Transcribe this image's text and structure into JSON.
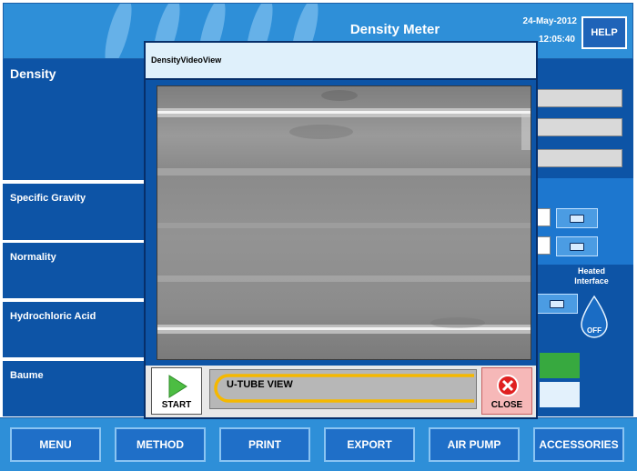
{
  "header": {
    "title": "Density Meter",
    "date": "24-May-2012",
    "time": "12:05:40",
    "help_label": "HELP"
  },
  "left_panels": {
    "density": "Density",
    "specific_gravity": "Specific Gravity",
    "normality": "Normality",
    "hydrochloric_acid": "Hydrochloric Acid",
    "baume": "Baume"
  },
  "right_panel": {
    "heated_interface_label": "Heated Interface",
    "heater_status": "OFF",
    "keyboard_icon": "keyboard-icon",
    "drop_icon": "water-drop-icon"
  },
  "dialog": {
    "title": "DensityVideoView",
    "video_label": "U-TUBE VIEW",
    "start_label": "START",
    "close_label": "CLOSE",
    "start_icon": "play-triangle-icon",
    "close_icon": "close-x-icon"
  },
  "footer": {
    "buttons": [
      "MENU",
      "METHOD",
      "PRINT",
      "EXPORT",
      "AIR PUMP",
      "ACCESSORIES"
    ]
  },
  "colors": {
    "header_blue": "#2e8fd8",
    "panel_navy": "#0d54a6",
    "accent_yellow": "#f5b800",
    "start_green": "#3fae3f",
    "close_red": "#e02020"
  }
}
